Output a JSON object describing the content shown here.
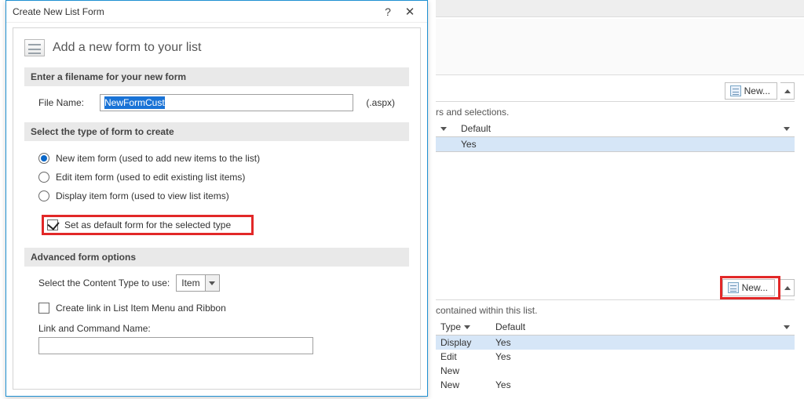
{
  "dialog": {
    "title": "Create New List Form",
    "add_heading": "Add a new form to your list",
    "filename_section": "Enter a filename for your new form",
    "filename_label": "File Name:",
    "filename_value": "NewFormCust",
    "filename_ext": "(.aspx)",
    "formtype_section": "Select the type of form to create",
    "radio_new": "New item form (used to add new items to the list)",
    "radio_edit": "Edit item form (used to edit existing list items)",
    "radio_display": "Display item form (used to view list items)",
    "set_default": "Set as default form for the selected type",
    "advanced_section": "Advanced form options",
    "content_type_label": "Select the Content Type to use:",
    "content_type_value": "Item",
    "create_link": "Create link in List Item Menu and Ribbon",
    "link_cmd_label": "Link and Command Name:"
  },
  "bg": {
    "upper_hint": "rs and selections.",
    "new_button": "New...",
    "col_default": "Default",
    "col_type": "Type",
    "row1_val": "Yes",
    "lower_hint": "contained within this list.",
    "forms": [
      {
        "type": "Display",
        "default": "Yes"
      },
      {
        "type": "Edit",
        "default": "Yes"
      },
      {
        "type": "New",
        "default": ""
      },
      {
        "type": "New",
        "default": "Yes"
      }
    ]
  }
}
